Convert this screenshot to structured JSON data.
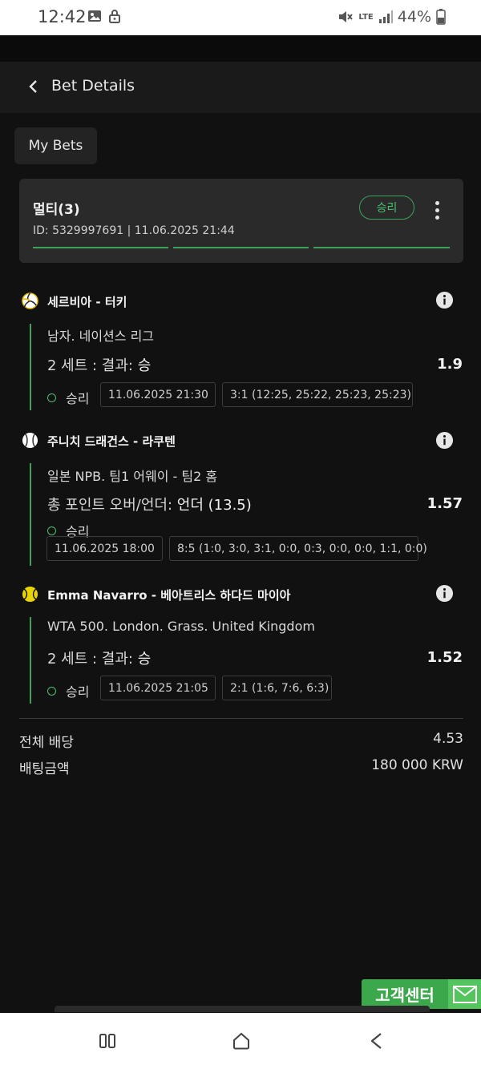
{
  "status_bar": {
    "time": "12:42",
    "network": "LTE",
    "battery": "44%"
  },
  "header": {
    "title": "Bet Details"
  },
  "my_bets_label": "My Bets",
  "bet": {
    "type": "멀티(3)",
    "meta": "ID: 5329997691  |  11.06.2025 21:44",
    "status_badge": "승리"
  },
  "events": [
    {
      "sport_icon": "volleyball-icon",
      "title": "세르비아 - 터키",
      "league": "남자. 네이션스 리그",
      "market": "2 세트 : 결과:",
      "selection": "승",
      "odds": "1.9",
      "status": "승리",
      "datetime": "11.06.2025 21:30",
      "score": "3:1 (12:25, 25:22, 25:23, 25:23)"
    },
    {
      "sport_icon": "baseball-icon",
      "title": "주니치 드래건스 - 라쿠텐",
      "league": "일본 NPB. 팀1 어웨이 - 팀2 홈",
      "market": "총 포인트 오버/언더:",
      "selection": "언더 (13.5)",
      "odds": "1.57",
      "status": "승리",
      "datetime": "11.06.2025 18:00",
      "score": "8:5 (1:0, 3:0, 3:1, 0:0, 0:3, 0:0, 0:0, 1:1, 0:0)"
    },
    {
      "sport_icon": "tennis-ball-icon",
      "title": "Emma Navarro - 베아트리스 하다드 마이아",
      "league": "WTA 500. London. Grass. United Kingdom",
      "market": "2 세트 : 결과:",
      "selection": "승",
      "odds": "1.52",
      "status": "승리",
      "datetime": "11.06.2025 21:05",
      "score": "2:1 (1:6, 7:6, 6:3)"
    }
  ],
  "summary": {
    "total_odds_label": "전체 배당",
    "total_odds_value": "4.53",
    "stake_label": "배팅금액",
    "stake_value": "180 000 KRW"
  },
  "customer_center_label": "고객센터",
  "colors": {
    "background": "#111111",
    "card": "#2a2a2a",
    "accent_green": "#3da35a",
    "cs_green": "#3aa84b"
  }
}
